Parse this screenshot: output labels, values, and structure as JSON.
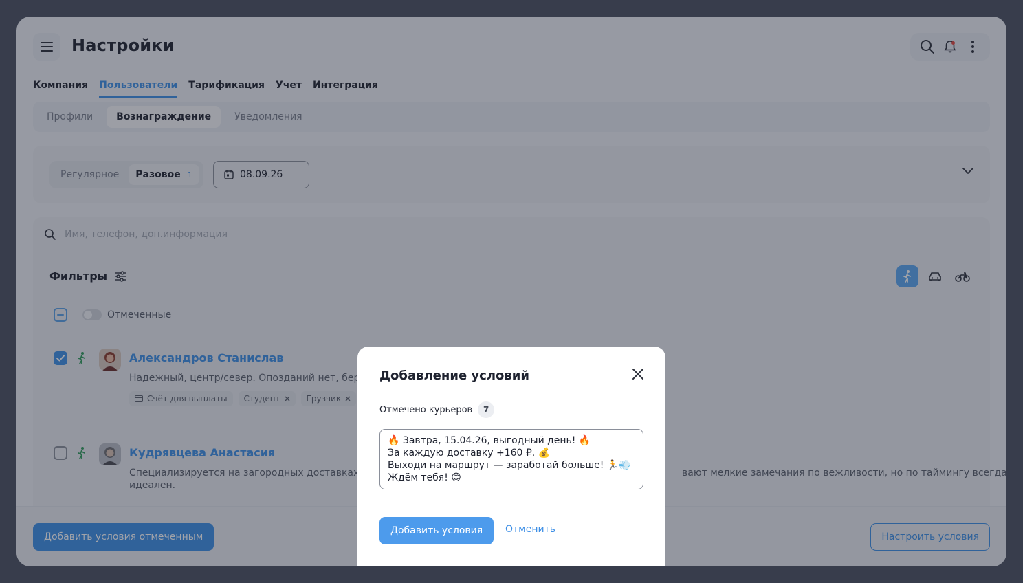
{
  "header": {
    "title": "Настройки"
  },
  "tabs": [
    {
      "label": "Компания",
      "active": false
    },
    {
      "label": "Пользователи",
      "active": true
    },
    {
      "label": "Тарификация",
      "active": false
    },
    {
      "label": "Учет",
      "active": false
    },
    {
      "label": "Интеграция",
      "active": false
    }
  ],
  "subtabs": [
    {
      "label": "Профили",
      "active": false
    },
    {
      "label": "Вознаграждение",
      "active": true
    },
    {
      "label": "Уведомления",
      "active": false
    }
  ],
  "reward_type": {
    "regular_label": "Регулярное",
    "one_time_label": "Разовое",
    "one_time_badge": "1",
    "date_value": "08.09.26"
  },
  "search": {
    "placeholder": "Имя, телефон, доп.информация"
  },
  "filters": {
    "label": "Фильтры",
    "transport_selected": "walk"
  },
  "marked_toggle": {
    "label": "Отмеченные"
  },
  "couriers": [
    {
      "name": "Александров Станислав",
      "description": "Надежный, центр/север. Опозданий нет, берет тя",
      "checked": true,
      "tags": [
        "Счёт для выплаты",
        "Студент",
        "Грузчик"
      ]
    },
    {
      "name": "Кудрявцева Анастасия",
      "description_left": "Специализируется на загородных доставках и э",
      "description_right": "вают мелкие замечания по вежливости, но по таймингу всегда",
      "description_line2": "идеален.",
      "checked": false
    }
  ],
  "bottom_bar": {
    "add_marked_label": "Добавить условия отмеченным",
    "configure_label": "Настроить условия"
  },
  "modal": {
    "title": "Добавление условий",
    "marked_label": "Отмечено курьеров",
    "marked_count": "7",
    "message_lines": [
      "🔥 Завтра, 15.04.26, выгодный день! 🔥",
      "За каждую доставку +160 ₽. 💰",
      "Выходи на маршрут — заработай больше! 🏃💨",
      "Ждём тебя! 😊"
    ],
    "submit_label": "Добавить условия",
    "cancel_label": "Отменить"
  },
  "colors": {
    "accent": "#3d8fe6",
    "overlay": "rgba(30,35,50,0.42)"
  }
}
